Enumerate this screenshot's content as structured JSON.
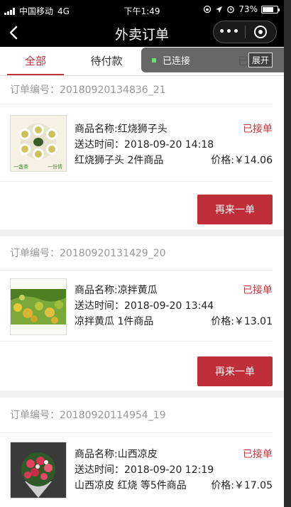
{
  "status_bar": {
    "carrier": "中国移动",
    "network": "4G",
    "time": "下午1:49",
    "battery": "73%",
    "battery_level": 0.73
  },
  "nav": {
    "title": "外卖订单",
    "more_icon": "more-dots-icon",
    "close_icon": "capsule-close-icon"
  },
  "tabs": [
    {
      "label": "全部",
      "active": true
    },
    {
      "label": "待付款",
      "active": false
    },
    {
      "label": "单",
      "active": false
    },
    {
      "label": "已完",
      "active": false
    }
  ],
  "debug_pill": {
    "status": "已连接",
    "expand": "展开",
    "indicator_color": "#6fe06f"
  },
  "orders": [
    {
      "number": "订单编号：20180920134836_21",
      "name": "商品名称:红烧狮子头",
      "status": "已接单",
      "delivery": "送达时间：2018-09-20 14:18",
      "summary": "红烧狮子头 2件商品",
      "price": "价格:￥14.06",
      "button": "再来一单",
      "thumb_label": "tea-cups-image",
      "thumb_caption_left": "一盏茶",
      "thumb_caption_right": "一份情"
    },
    {
      "number": "订单编号：20180920131429_20",
      "name": "商品名称:凉拌黄瓜",
      "status": "已接单",
      "delivery": "送达时间：2018-09-20 13:44",
      "summary": "凉拌黄瓜 1件商品",
      "price": "价格:￥13.01",
      "button": "再来一单",
      "thumb_label": "ginkgo-leaves-image"
    },
    {
      "number": "订单编号：20180920114954_19",
      "name": "商品名称:山西凉皮",
      "status": "已接单",
      "delivery": "送达时间：2018-09-20 12:19",
      "summary": "山西凉皮 红烧 等5件商品",
      "price": "价格:￥17.05",
      "thumb_label": "flower-bouquet-image"
    }
  ],
  "colors": {
    "accent": "#c0343d",
    "button_bg": "#bf2f3a",
    "muted_text": "#999999"
  }
}
